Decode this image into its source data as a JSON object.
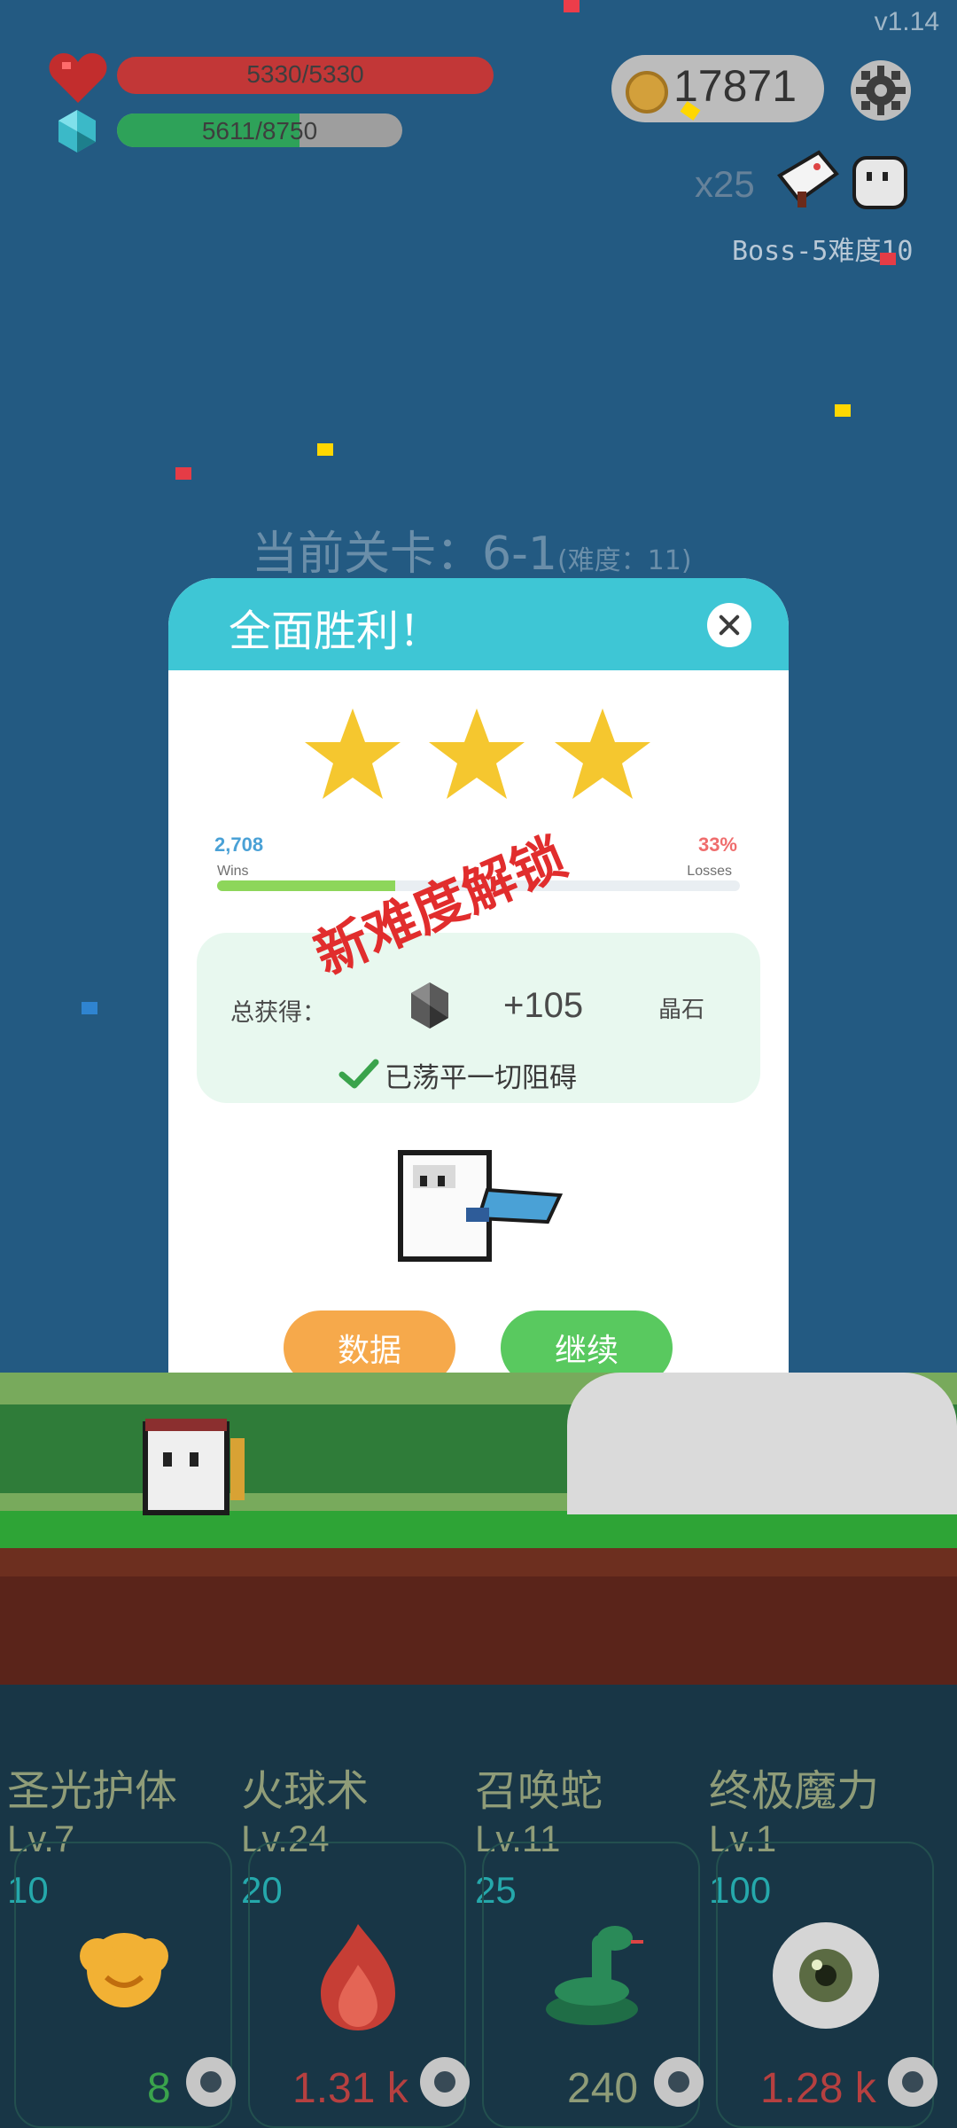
{
  "hud": {
    "version": "v1.14",
    "hp": "5330/5330",
    "mp": "5611/8750",
    "coins": "17871",
    "multiplier": "x25",
    "boss_difficulty": "Boss-5难度10"
  },
  "stage": {
    "label": "当前关卡：6-1",
    "difficulty": "(难度：11)"
  },
  "modal": {
    "title": "全面胜利！",
    "wins_value": "2,708",
    "wins_label": "Wins",
    "losses_value": "33%",
    "losses_label": "Losses",
    "unlock_text": "新难度解锁",
    "reward_total_label": "总获得：",
    "reward_value": "+105",
    "reward_unit": "晶石",
    "reward_note": "已荡平一切阻碍",
    "data_button": "数据",
    "continue_button": "继续"
  },
  "skills": [
    {
      "name": "圣光护体",
      "level": "Lv.7",
      "cost": "10",
      "count": "8",
      "count_color": "#3aa34c"
    },
    {
      "name": "火球术",
      "level": "Lv.24",
      "cost": "20",
      "count": "1.31 k",
      "count_color": "#b64040"
    },
    {
      "name": "召唤蛇",
      "level": "Lv.11",
      "cost": "25",
      "count": "240",
      "count_color": "#8f9c78"
    },
    {
      "name": "终极魔力",
      "level": "Lv.1",
      "cost": "100",
      "count": "1.28 k",
      "count_color": "#b64040"
    }
  ],
  "colors": {
    "background": "#235a82",
    "modal_header": "#3ec6d5",
    "button_data": "#f6a94b",
    "button_continue": "#59c95f"
  },
  "icons": {
    "heart": "heart-icon",
    "gem": "gem-icon",
    "coin": "coin-icon",
    "gear": "gear-icon",
    "cleaver": "cleaver-icon",
    "ghost": "ghost-icon",
    "close": "close-icon",
    "star": "star-icon",
    "check": "check-icon"
  }
}
